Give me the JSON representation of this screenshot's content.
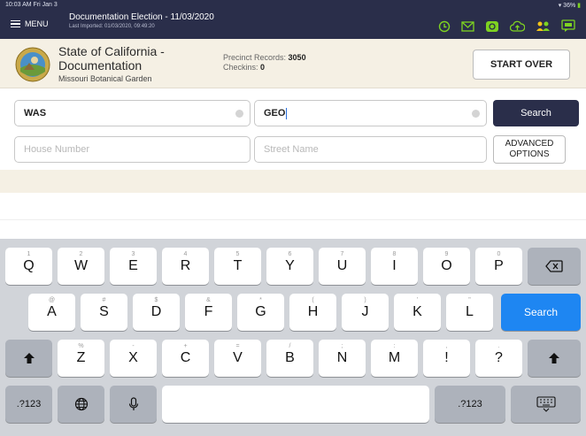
{
  "status_bar": {
    "time": "10:03 AM  Fri Jan 3",
    "battery": "36%"
  },
  "topbar": {
    "menu_label": "MENU",
    "election_title": "Documentation Election - 11/03/2020",
    "last_imported": "Last Imported: 01/03/2020, 09:49:20",
    "icons": [
      "history-icon",
      "mail-icon",
      "sync-icon",
      "cloud-upload-icon",
      "users-icon",
      "chat-icon"
    ],
    "icon_color": "#7ed321"
  },
  "header": {
    "org_name": "State of California - Documentation",
    "org_location": "Missouri Botanical Garden",
    "precinct_label": "Precinct Records:",
    "precinct_value": "3050",
    "checkins_label": "Checkins:",
    "checkins_value": "0",
    "start_over_label": "START OVER"
  },
  "search": {
    "last_name_value": "WAS",
    "first_name_value": "GEO",
    "house_number_placeholder": "House Number",
    "street_name_placeholder": "Street Name",
    "search_label": "Search",
    "advanced_label_line1": "ADVANCED",
    "advanced_label_line2": "OPTIONS"
  },
  "keyboard": {
    "row1": [
      {
        "label": "Q",
        "alt": "1"
      },
      {
        "label": "W",
        "alt": "2"
      },
      {
        "label": "E",
        "alt": "3"
      },
      {
        "label": "R",
        "alt": "4"
      },
      {
        "label": "T",
        "alt": "5"
      },
      {
        "label": "Y",
        "alt": "6"
      },
      {
        "label": "U",
        "alt": "7"
      },
      {
        "label": "I",
        "alt": "8"
      },
      {
        "label": "O",
        "alt": "9"
      },
      {
        "label": "P",
        "alt": "0"
      }
    ],
    "row2": [
      {
        "label": "A",
        "alt": "@"
      },
      {
        "label": "S",
        "alt": "#"
      },
      {
        "label": "D",
        "alt": "$"
      },
      {
        "label": "F",
        "alt": "&"
      },
      {
        "label": "G",
        "alt": "*"
      },
      {
        "label": "H",
        "alt": "("
      },
      {
        "label": "J",
        "alt": ")"
      },
      {
        "label": "K",
        "alt": "'"
      },
      {
        "label": "L",
        "alt": "\""
      }
    ],
    "row3": [
      {
        "label": "Z",
        "alt": "%"
      },
      {
        "label": "X",
        "alt": "-"
      },
      {
        "label": "C",
        "alt": "+"
      },
      {
        "label": "V",
        "alt": "="
      },
      {
        "label": "B",
        "alt": "/"
      },
      {
        "label": "N",
        "alt": ";"
      },
      {
        "label": "M",
        "alt": ":"
      },
      {
        "label": "!",
        "alt": ","
      },
      {
        "label": "?",
        "alt": "."
      }
    ],
    "search_key": "Search",
    "numbers_key_left": ".?123",
    "numbers_key_right": ".?123",
    "search_key_color": "#1e86f2"
  }
}
